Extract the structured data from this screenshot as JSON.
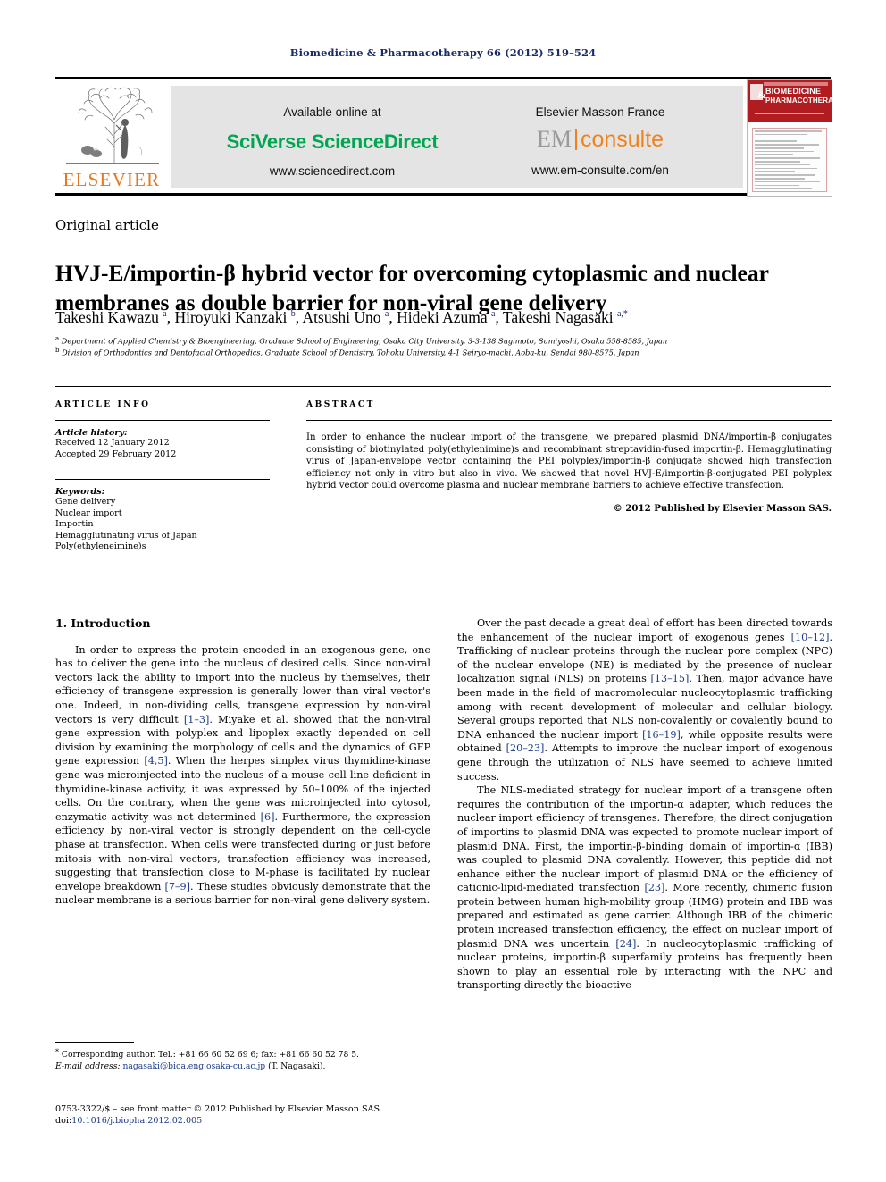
{
  "running_head": "Biomedicine & Pharmacotherapy 66 (2012) 519–524",
  "masthead": {
    "publisher_logo_text": "ELSEVIER",
    "available_online_label": "Available online at",
    "sciencedirect_brand": "SciVerse ScienceDirect",
    "sciencedirect_url": "www.sciencedirect.com",
    "masson_label": "Elsevier Masson France",
    "em_prefix": "EM",
    "em_suffix": "consulte",
    "em_url": "www.em-consulte.com/en",
    "cover": {
      "title_line1": "BIOMEDICINE",
      "title_line2": "PHARMACOTHERAPY",
      "ampersand": "&"
    }
  },
  "article": {
    "type": "Original article",
    "title": "HVJ-E/importin-β hybrid vector for overcoming cytoplasmic and nuclear membranes as double barrier for non-viral gene delivery",
    "authors_html": "Takeshi Kawazu <sup>a</sup>, Hiroyuki Kanzaki <sup>b</sup>, Atsushi Uno <sup>a</sup>, Hideki Azuma <sup>a</sup>, Takeshi Nagasaki <sup>a,</sup><sup>*</sup>",
    "affiliation_a": "Department of Applied Chemistry & Bioengineering, Graduate School of Engineering, Osaka City University, 3-3-138 Sugimoto, Sumiyoshi, Osaka 558-8585, Japan",
    "affiliation_b": "Division of Orthodontics and Dentofacial Orthopedics, Graduate School of Dentistry, Tohoku University, 4-1 Seiryo-machi, Aoba-ku, Sendai 980-8575, Japan",
    "affiliation_a_marker": "a",
    "affiliation_b_marker": "b"
  },
  "info": {
    "heading": "ARTICLE INFO",
    "history_label": "Article history:",
    "received": "Received 12 January 2012",
    "accepted": "Accepted 29 February 2012",
    "keywords_label": "Keywords:",
    "keywords": [
      "Gene delivery",
      "Nuclear import",
      "Importin",
      "Hemagglutinating virus of Japan",
      "Poly(ethyleneimine)s"
    ]
  },
  "abstract": {
    "heading": "ABSTRACT",
    "text": "In order to enhance the nuclear import of the transgene, we prepared plasmid DNA/importin-β conjugates consisting of biotinylated poly(ethylenimine)s and recombinant streptavidin-fused importin-β. Hemagglutinating virus of Japan-envelope vector containing the PEI polyplex/importin-β conjugate showed high transfection efficiency not only in vitro but also in vivo. We showed that novel HVJ-E/importin-β-conjugated PEI polyplex hybrid vector could overcome plasma and nuclear membrane barriers to achieve effective transfection.",
    "copyright": "© 2012 Published by Elsevier Masson SAS."
  },
  "body": {
    "section_heading": "1. Introduction",
    "left_p1_a": "In order to express the protein encoded in an exogenous gene, one has to deliver the gene into the nucleus of desired cells. Since non-viral vectors lack the ability to import into the nucleus by themselves, their efficiency of transgene expression is generally lower than viral vector's one. Indeed, in non-dividing cells, transgene expression by non-viral vectors is very difficult ",
    "left_ref_1_3": "[1–3]",
    "left_p1_b": ". Miyake et al. showed that the non-viral gene expression with polyplex and lipoplex exactly depended on cell division by examining the morphology of cells and the dynamics of GFP gene expression ",
    "left_ref_4_5": "[4,5]",
    "left_p1_c": ". When the herpes simplex virus thymidine-kinase gene was microinjected into the nucleus of a mouse cell line deficient in thymidine-kinase activity, it was expressed by 50–100% of the injected cells. On the contrary, when the gene was microinjected into cytosol, enzymatic activity was not determined ",
    "left_ref_6": "[6]",
    "left_p1_d": ". Furthermore, the expression efficiency by non-viral vector is strongly dependent on the cell-cycle phase at transfection. When cells were transfected during or just before mitosis with non-viral vectors, transfection efficiency was increased, suggesting that transfection close to M-phase is facilitated by nuclear envelope breakdown ",
    "left_ref_7_9": "[7–9]",
    "left_p1_e": ". These studies obviously demonstrate that the nuclear membrane is a serious barrier for non-viral gene delivery system.",
    "right_p1_a": "Over the past decade a great deal of effort has been directed towards the enhancement of the nuclear import of exogenous genes ",
    "right_ref_10_12": "[10–12]",
    "right_p1_b": ". Trafficking of nuclear proteins through the nuclear pore complex (NPC) of the nuclear envelope (NE) is mediated by the presence of nuclear localization signal (NLS) on proteins ",
    "right_ref_13_15": "[13–15]",
    "right_p1_c": ". Then, major advance have been made in the field of macromolecular nucleocytoplasmic trafficking among with recent development of molecular and cellular biology. Several groups reported that NLS non-covalently or covalently bound to DNA enhanced the nuclear import ",
    "right_ref_16_19": "[16–19]",
    "right_p1_d": ", while opposite results were obtained ",
    "right_ref_20_23": "[20–23]",
    "right_p1_e": ". Attempts to improve the nuclear import of exogenous gene through the utilization of NLS have seemed to achieve limited success.",
    "right_p2_a": "The NLS-mediated strategy for nuclear import of a transgene often requires the contribution of the importin-α adapter, which reduces the nuclear import efficiency of transgenes. Therefore, the direct conjugation of importins to plasmid DNA was expected to promote nuclear import of plasmid DNA. First, the importin-β-binding domain of importin-α (IBB) was coupled to plasmid DNA covalently. However, this peptide did not enhance either the nuclear import of plasmid DNA or the efficiency of cationic-lipid-mediated transfection ",
    "right_ref_23": "[23]",
    "right_p2_b": ". More recently, chimeric fusion protein between human high-mobility group (HMG) protein and IBB was prepared and estimated as gene carrier. Although IBB of the chimeric protein increased transfection efficiency, the effect on nuclear import of plasmid DNA was uncertain ",
    "right_ref_24": "[24]",
    "right_p2_c": ". In nucleocytoplasmic trafficking of nuclear proteins, importin-β superfamily proteins has frequently been shown to play an essential role by interacting with the NPC and transporting directly the bioactive"
  },
  "footer": {
    "corresponding_marker": "*",
    "corresponding_text": "Corresponding author. Tel.: +81 66 60 52 69 6; fax: +81 66 60 52 78 5.",
    "email_label": "E-mail address:",
    "email": "nagasaki@bioa.eng.osaka-cu.ac.jp",
    "email_owner": "(T. Nagasaki).",
    "issn_line": "0753-3322/$ – see front matter © 2012 Published by Elsevier Masson SAS.",
    "doi_label": "doi:",
    "doi": "10.1016/j.biopha.2012.02.005"
  },
  "colors": {
    "running_head": "#1a2a6c",
    "elsevier_orange": "#E8761A",
    "sciencedirect_green": "#00a650",
    "em_orange": "#f0821e",
    "reference_blue": "#1a3a8c",
    "cover_red": "#b01c20"
  }
}
